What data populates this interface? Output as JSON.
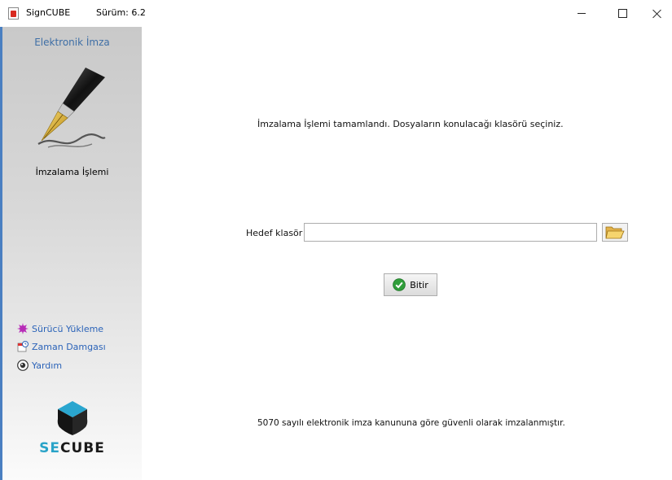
{
  "window": {
    "title": "SignCUBE",
    "version": "Sürüm: 6.2"
  },
  "sidebar": {
    "title": "Elektronik İmza",
    "current_step": "İmzalama İşlemi",
    "links": [
      {
        "label": "Sürücü Yükleme",
        "icon": "driver-install-icon"
      },
      {
        "label": "Zaman Damgası",
        "icon": "timestamp-icon"
      },
      {
        "label": "Yardım",
        "icon": "help-icon"
      }
    ],
    "logo": {
      "accent": "SE",
      "rest": "CUBE"
    }
  },
  "main": {
    "message": "İmzalama İşlemi tamamlandı. Dosyaların konulacağı klasörü seçiniz.",
    "target_folder_label": "Hedef klasör",
    "target_folder_value": "",
    "browse_icon": "folder-open-icon",
    "finish_label": "Bitir",
    "footer": "5070 sayılı elektronik imza kanununa göre güvenli olarak imzalanmıştır."
  },
  "colors": {
    "accent_blue": "#3f6fa6",
    "link_blue": "#2b63b8",
    "logo_accent": "#29a3c8"
  }
}
